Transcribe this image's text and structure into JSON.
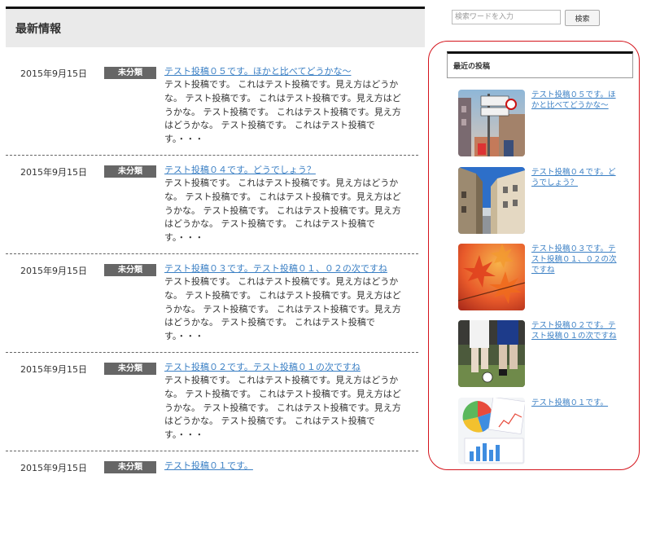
{
  "main": {
    "heading": "最新情報",
    "posts": [
      {
        "date": "2015年9月15日",
        "category": "未分類",
        "title": "テスト投稿０５です。ほかと比べてどうかな〜",
        "excerpt": "テスト投稿です。 これはテスト投稿です。見え方はどうかな。 テスト投稿です。 これはテスト投稿です。見え方はどうかな。 テスト投稿です。 これはテスト投稿です。見え方はどうかな。 テスト投稿です。 これはテスト投稿です。・・・"
      },
      {
        "date": "2015年9月15日",
        "category": "未分類",
        "title": "テスト投稿０４です。どうでしょう？",
        "excerpt": "テスト投稿です。 これはテスト投稿です。見え方はどうかな。 テスト投稿です。 これはテスト投稿です。見え方はどうかな。 テスト投稿です。 これはテスト投稿です。見え方はどうかな。 テスト投稿です。 これはテスト投稿です。・・・"
      },
      {
        "date": "2015年9月15日",
        "category": "未分類",
        "title": "テスト投稿０３です。テスト投稿０１、０２の次ですね",
        "excerpt": "テスト投稿です。 これはテスト投稿です。見え方はどうかな。 テスト投稿です。 これはテスト投稿です。見え方はどうかな。 テスト投稿です。 これはテスト投稿です。見え方はどうかな。 テスト投稿です。 これはテスト投稿です。・・・"
      },
      {
        "date": "2015年9月15日",
        "category": "未分類",
        "title": "テスト投稿０２です。テスト投稿０１の次ですね",
        "excerpt": "テスト投稿です。 これはテスト投稿です。見え方はどうかな。 テスト投稿です。 これはテスト投稿です。見え方はどうかな。 テスト投稿です。 これはテスト投稿です。見え方はどうかな。 テスト投稿です。 これはテスト投稿です。・・・"
      },
      {
        "date": "2015年9月15日",
        "category": "未分類",
        "title": "テスト投稿０１です。",
        "excerpt": ""
      }
    ]
  },
  "search": {
    "placeholder": "検索ワードを入力",
    "button_label": "検索"
  },
  "sidebar": {
    "recent_heading": "最近の投稿",
    "recent_posts": [
      {
        "title": "テスト投稿０５です。ほかと比べてどうかな〜",
        "thumb": "street-signs-photo"
      },
      {
        "title": "テスト投稿０４です。どうでしょう？",
        "thumb": "european-buildings-photo"
      },
      {
        "title": "テスト投稿０３です。テスト投稿０１、０２の次ですね",
        "thumb": "autumn-maple-leaves-photo"
      },
      {
        "title": "テスト投稿０２です。テスト投稿０１の次ですね",
        "thumb": "soccer-players-photo"
      },
      {
        "title": "テスト投稿０１です。",
        "thumb": "charts-documents-photo"
      }
    ]
  },
  "colors": {
    "link": "#3a7fc4",
    "category_badge": "#666666",
    "highlight_circle": "#d4141c"
  }
}
